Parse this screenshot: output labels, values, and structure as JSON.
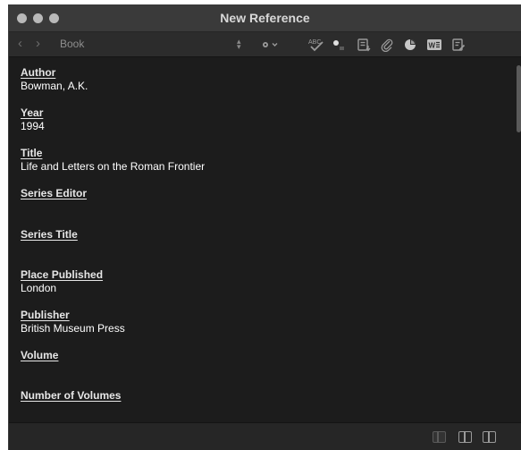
{
  "window": {
    "title": "New Reference"
  },
  "toolbar": {
    "reference_type": "Book"
  },
  "fields": [
    {
      "label": "Author",
      "value": "Bowman, A.K."
    },
    {
      "label": "Year",
      "value": "1994"
    },
    {
      "label": "Title",
      "value": "Life and Letters on the Roman Frontier"
    },
    {
      "label": "Series Editor",
      "value": ""
    },
    {
      "label": "Series Title",
      "value": ""
    },
    {
      "label": "Place Published",
      "value": "London"
    },
    {
      "label": "Publisher",
      "value": "British Museum Press"
    },
    {
      "label": "Volume",
      "value": ""
    },
    {
      "label": "Number of Volumes",
      "value": ""
    }
  ],
  "icons": {
    "back": "chevron-left-icon",
    "forward": "chevron-right-icon",
    "gear": "gear-icon",
    "spellcheck": "spellcheck-icon",
    "pen": "pen-icon",
    "insert": "insert-citation-icon",
    "attach": "paperclip-icon",
    "chart": "pie-chart-icon",
    "word": "word-icon",
    "edit": "edit-note-icon",
    "layouts": [
      "layout-single-icon",
      "layout-split-icon",
      "layout-right-icon"
    ]
  },
  "colors": {
    "background": "#1c1c1c",
    "titlebar": "#3a3a3a",
    "toolbar": "#2c2c2c",
    "text": "#ffffff"
  }
}
